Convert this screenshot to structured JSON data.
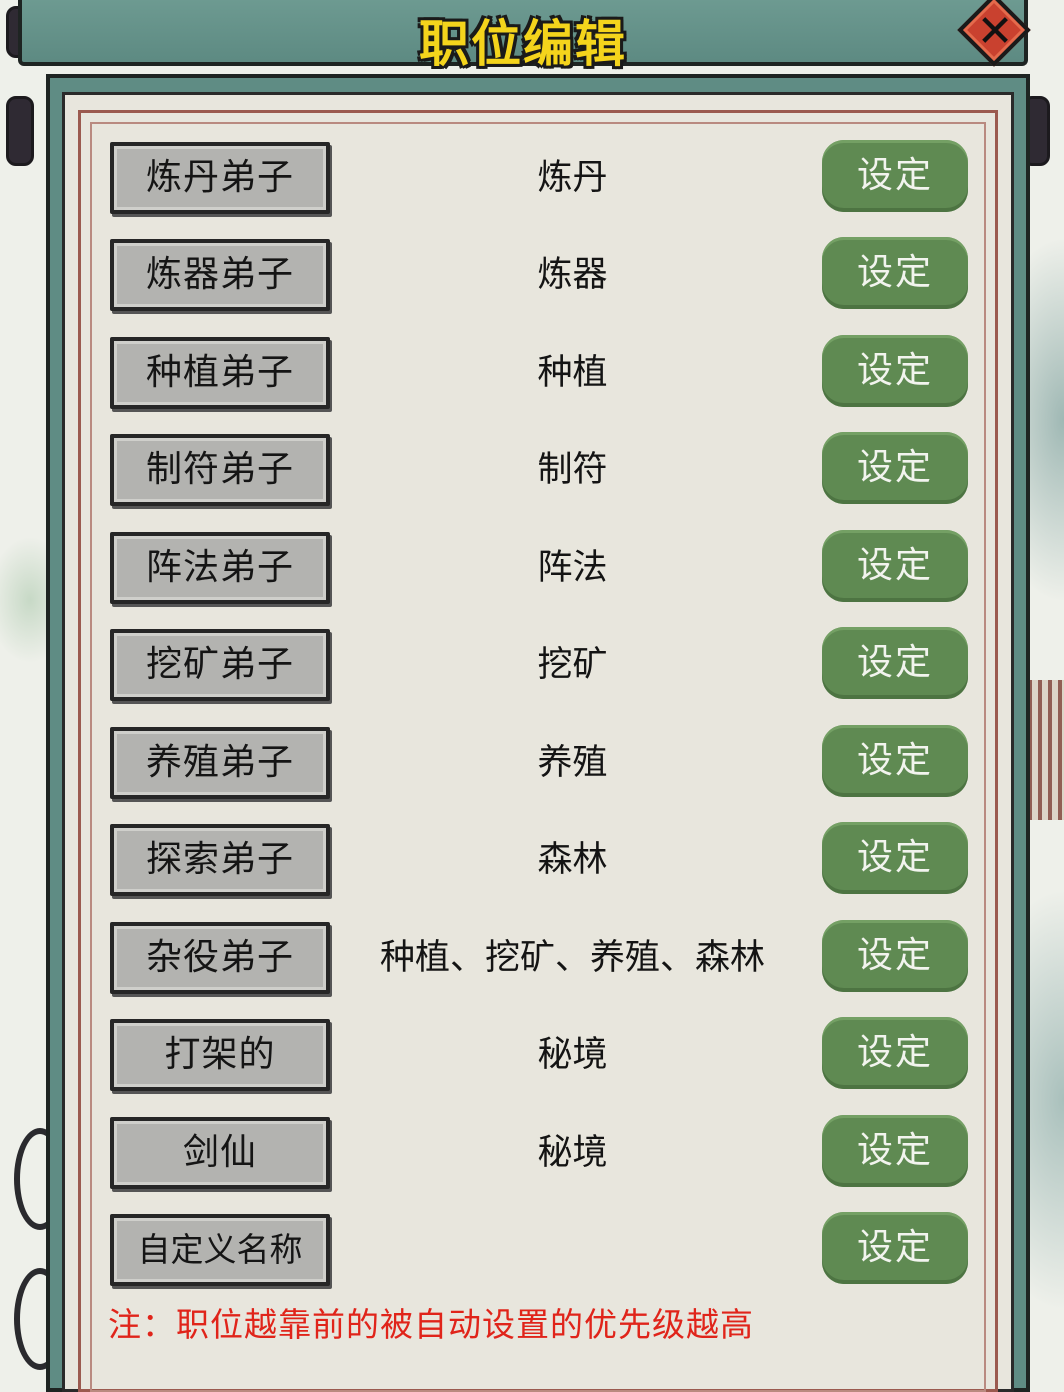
{
  "dialog": {
    "title": "职位编辑",
    "close_icon": "close-icon"
  },
  "rows": [
    {
      "role": "炼丹弟子",
      "duty": "炼丹",
      "action": "设定"
    },
    {
      "role": "炼器弟子",
      "duty": "炼器",
      "action": "设定"
    },
    {
      "role": "种植弟子",
      "duty": "种植",
      "action": "设定"
    },
    {
      "role": "制符弟子",
      "duty": "制符",
      "action": "设定"
    },
    {
      "role": "阵法弟子",
      "duty": "阵法",
      "action": "设定"
    },
    {
      "role": "挖矿弟子",
      "duty": "挖矿",
      "action": "设定"
    },
    {
      "role": "养殖弟子",
      "duty": "养殖",
      "action": "设定"
    },
    {
      "role": "探索弟子",
      "duty": "森林",
      "action": "设定"
    },
    {
      "role": "杂役弟子",
      "duty": "种植、挖矿、养殖、森林",
      "action": "设定"
    },
    {
      "role": "打架的",
      "duty": "秘境",
      "action": "设定"
    },
    {
      "role": "剑仙",
      "duty": "秘境",
      "action": "设定"
    },
    {
      "role": "自定义名称",
      "duty": "",
      "action": "设定"
    }
  ],
  "note": "注：职位越靠前的被自动设置的优先级越高",
  "colors": {
    "title_text": "#f4d41c",
    "panel_teal": "#5f8c84",
    "set_button_green": "#5f8a52",
    "role_button_gray": "#b3b3b0",
    "note_red": "#e0241a"
  }
}
